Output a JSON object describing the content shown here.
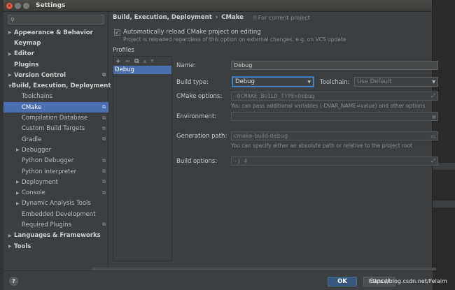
{
  "window": {
    "title": "Settings"
  },
  "search": {
    "placeholder": "",
    "value": ""
  },
  "sidebar": {
    "items": [
      {
        "label": "Appearance & Behavior",
        "bold": true,
        "arrow": "▶",
        "indent": 0,
        "project": false
      },
      {
        "label": "Keymap",
        "bold": true,
        "arrow": "",
        "indent": 0,
        "project": false
      },
      {
        "label": "Editor",
        "bold": true,
        "arrow": "▶",
        "indent": 0,
        "project": false
      },
      {
        "label": "Plugins",
        "bold": true,
        "arrow": "",
        "indent": 0,
        "project": false
      },
      {
        "label": "Version Control",
        "bold": true,
        "arrow": "▶",
        "indent": 0,
        "project": true
      },
      {
        "label": "Build, Execution, Deployment",
        "bold": true,
        "arrow": "▼",
        "indent": 0,
        "project": false
      },
      {
        "label": "Toolchains",
        "bold": false,
        "arrow": "",
        "indent": 1,
        "project": false
      },
      {
        "label": "CMake",
        "bold": false,
        "arrow": "",
        "indent": 1,
        "project": true,
        "selected": true
      },
      {
        "label": "Compilation Database",
        "bold": false,
        "arrow": "",
        "indent": 1,
        "project": true
      },
      {
        "label": "Custom Build Targets",
        "bold": false,
        "arrow": "",
        "indent": 1,
        "project": true
      },
      {
        "label": "Gradle",
        "bold": false,
        "arrow": "",
        "indent": 1,
        "project": true
      },
      {
        "label": "Debugger",
        "bold": false,
        "arrow": "▶",
        "indent": 1,
        "project": false
      },
      {
        "label": "Python Debugger",
        "bold": false,
        "arrow": "",
        "indent": 1,
        "project": true
      },
      {
        "label": "Python Interpreter",
        "bold": false,
        "arrow": "",
        "indent": 1,
        "project": true
      },
      {
        "label": "Deployment",
        "bold": false,
        "arrow": "▶",
        "indent": 1,
        "project": true
      },
      {
        "label": "Console",
        "bold": false,
        "arrow": "▶",
        "indent": 1,
        "project": true
      },
      {
        "label": "Dynamic Analysis Tools",
        "bold": false,
        "arrow": "▶",
        "indent": 1,
        "project": false
      },
      {
        "label": "Embedded Development",
        "bold": false,
        "arrow": "",
        "indent": 1,
        "project": false
      },
      {
        "label": "Required Plugins",
        "bold": false,
        "arrow": "",
        "indent": 1,
        "project": true
      },
      {
        "label": "Languages & Frameworks",
        "bold": true,
        "arrow": "▶",
        "indent": 0,
        "project": false
      },
      {
        "label": "Tools",
        "bold": true,
        "arrow": "▶",
        "indent": 0,
        "project": false
      }
    ]
  },
  "header": {
    "crumb_parent": "Build, Execution, Deployment",
    "crumb_sep": "›",
    "crumb_current": "CMake",
    "for_project": "For current project"
  },
  "autoreload": {
    "checked": true,
    "label": "Automatically reload CMake project on editing",
    "hint": "Project is reloaded regardless of this option on external changes, e.g. on VCS update"
  },
  "profiles": {
    "label": "Profiles",
    "toolbar": [
      "+",
      "−",
      "⧉",
      "▲",
      "▼"
    ],
    "items": [
      "Debug"
    ]
  },
  "form": {
    "name_label": "Name:",
    "name_value": "Debug",
    "build_type_label": "Build type:",
    "build_type_value": "Debug",
    "toolchain_label": "Toolchain:",
    "toolchain_value": "Use Default",
    "cmake_options_label": "CMake options:",
    "cmake_options_value": "-DCMAKE_BUILD_TYPE=Debug",
    "cmake_options_hint": "You can pass additional variables (-DVAR_NAME=value) and other options",
    "environment_label": "Environment:",
    "environment_value": "",
    "generation_path_label": "Generation path:",
    "generation_path_value": "cmake-build-debug",
    "generation_path_hint": "You can specify either an absolute path or relative to the project root",
    "build_options_label": "Build options:",
    "build_options_value": "-j 4"
  },
  "footer": {
    "help": "?",
    "ok": "OK",
    "cancel": "Cancel"
  },
  "watermark": "https://blog.csdn.net/Felaim",
  "colors": {
    "selection": "#4b6eaf",
    "background": "#3c3f41",
    "ok_button": "#365880"
  }
}
